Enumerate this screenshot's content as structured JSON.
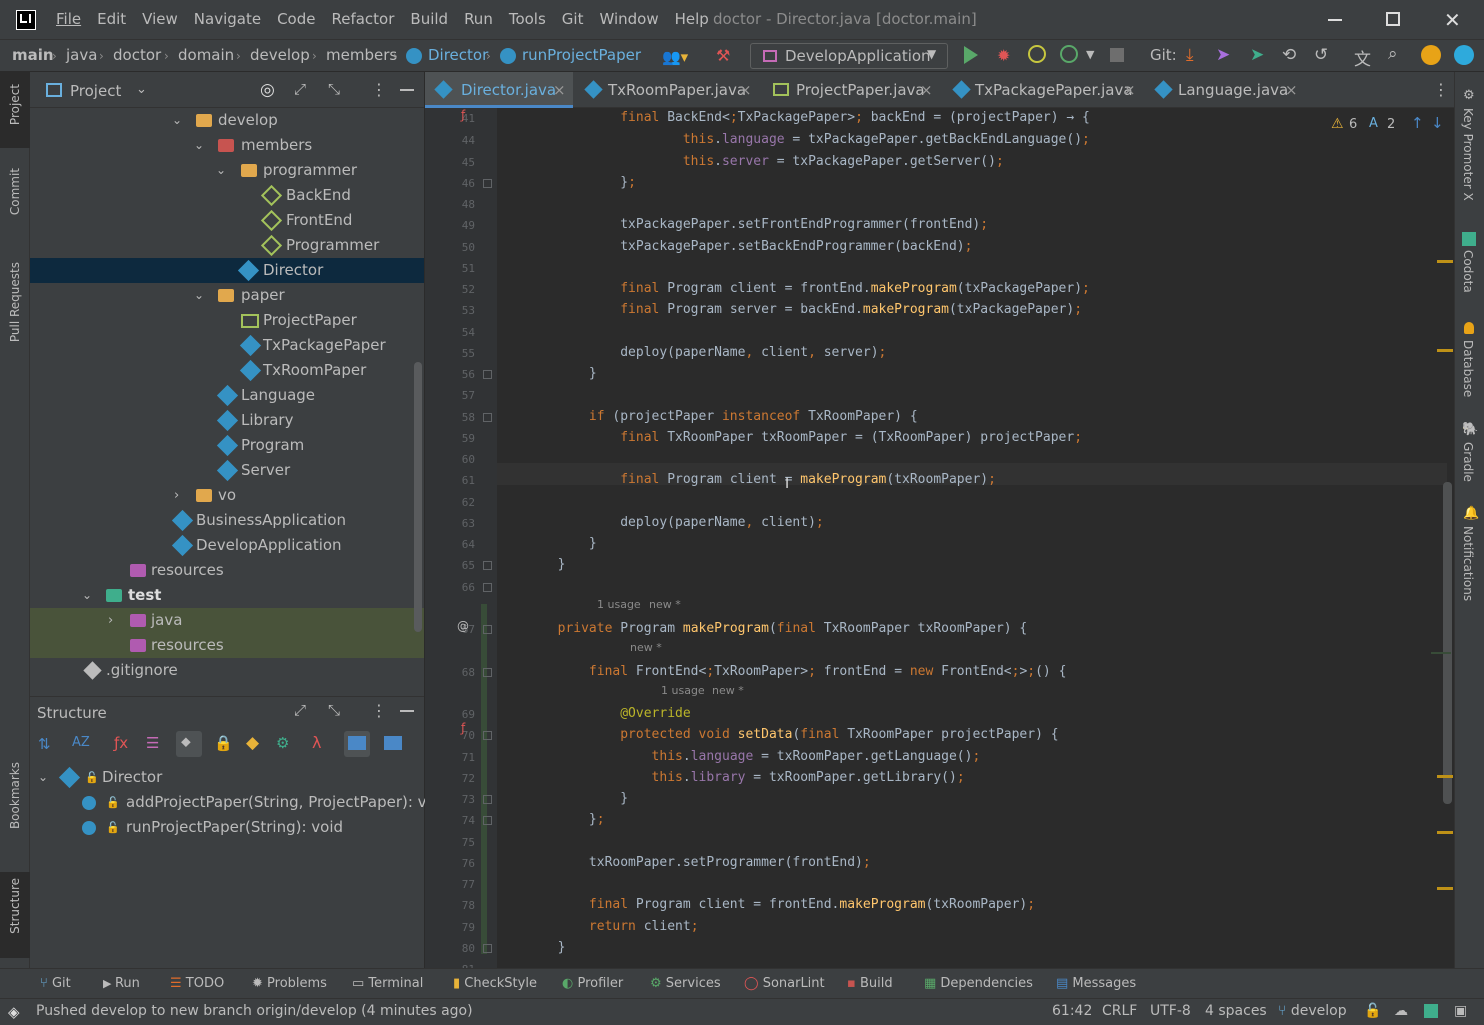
{
  "title_bar": {
    "menus": [
      "File",
      "Edit",
      "View",
      "Navigate",
      "Code",
      "Refactor",
      "Build",
      "Run",
      "Tools",
      "Git",
      "Window",
      "Help"
    ],
    "window_title": "doctor - Director.java [doctor.main]"
  },
  "nav": {
    "crumbs": [
      "main",
      "java",
      "doctor",
      "domain",
      "develop",
      "members",
      "Director",
      "runProjectPaper"
    ],
    "run_config": "DevelopApplication",
    "git_label": "Git:"
  },
  "left_strip": {
    "project": "Project",
    "commit": "Commit",
    "pull_requests": "Pull Requests",
    "bookmarks": "Bookmarks",
    "structure": "Structure"
  },
  "right_strip": {
    "key_promoter": "Key Promoter X",
    "codota": "Codota",
    "database": "Database",
    "gradle": "Gradle",
    "notifications": "Notifications"
  },
  "project_panel": {
    "title": "Project",
    "tree": [
      {
        "label": "develop",
        "kind": "folder"
      },
      {
        "label": "members",
        "kind": "folder-pkg"
      },
      {
        "label": "programmer",
        "kind": "folder"
      },
      {
        "label": "BackEnd",
        "kind": "class-g"
      },
      {
        "label": "FrontEnd",
        "kind": "class-g"
      },
      {
        "label": "Programmer",
        "kind": "class-g"
      },
      {
        "label": "Director",
        "kind": "class"
      },
      {
        "label": "paper",
        "kind": "folder"
      },
      {
        "label": "ProjectPaper",
        "kind": "iface"
      },
      {
        "label": "TxPackagePaper",
        "kind": "class"
      },
      {
        "label": "TxRoomPaper",
        "kind": "class"
      },
      {
        "label": "Language",
        "kind": "class"
      },
      {
        "label": "Library",
        "kind": "class"
      },
      {
        "label": "Program",
        "kind": "class"
      },
      {
        "label": "Server",
        "kind": "class"
      },
      {
        "label": "vo",
        "kind": "folder"
      },
      {
        "label": "BusinessApplication",
        "kind": "class"
      },
      {
        "label": "DevelopApplication",
        "kind": "class"
      },
      {
        "label": "resources",
        "kind": "res"
      },
      {
        "label": "test",
        "kind": "folder-test"
      },
      {
        "label": "java",
        "kind": "src-test"
      },
      {
        "label": "resources",
        "kind": "res"
      },
      {
        "label": ".gitignore",
        "kind": "file"
      }
    ]
  },
  "structure_panel": {
    "title": "Structure",
    "root": "Director",
    "members": [
      "addProjectPaper(String, ProjectPaper): void",
      "runProjectPaper(String): void"
    ]
  },
  "editor": {
    "tabs": [
      "Director.java",
      "TxRoomPaper.java",
      "ProjectPaper.java",
      "TxPackagePaper.java",
      "Language.java"
    ],
    "inspections": {
      "warnings": "6",
      "typos": "2"
    },
    "line_numbers": [
      "41",
      "44",
      "45",
      "46",
      "48",
      "49",
      "50",
      "51",
      "52",
      "53",
      "54",
      "55",
      "56",
      "57",
      "58",
      "59",
      "60",
      "61",
      "62",
      "63",
      "64",
      "65",
      "66",
      "67",
      "68",
      "69",
      "70",
      "71",
      "72",
      "73",
      "74",
      "75",
      "76",
      "77",
      "78",
      "79",
      "80",
      "81"
    ],
    "lines": [
      "                final BackEnd<TxPackagePaper> backEnd = (projectPaper) → {",
      "                        this.language = txPackagePaper.getBackEndLanguage();",
      "                        this.server = txPackagePaper.getServer();",
      "                };",
      "",
      "                txPackagePaper.setFrontEndProgrammer(frontEnd);",
      "                txPackagePaper.setBackEndProgrammer(backEnd);",
      "",
      "                final Program client = frontEnd.makeProgram(txPackagePaper);",
      "                final Program server = backEnd.makeProgram(txPackagePaper);",
      "",
      "                deploy(paperName, client, server);",
      "            }",
      "",
      "            if (projectPaper instanceof TxRoomPaper) {",
      "                final TxRoomPaper txRoomPaper = (TxRoomPaper) projectPaper;",
      "",
      "                final Program client = makeProgram(txRoomPaper);",
      "",
      "                deploy(paperName, client);",
      "            }",
      "        }",
      "",
      "        private Program makeProgram(final TxRoomPaper txRoomPaper) {",
      "            final FrontEnd<TxRoomPaper> frontEnd = new FrontEnd<>() {",
      "                @Override",
      "                protected void setData(final TxRoomPaper projectPaper) {",
      "                    this.language = txRoomPaper.getLanguage();",
      "                    this.library = txRoomPaper.getLibrary();",
      "                }",
      "            };",
      "",
      "            txRoomPaper.setProgrammer(frontEnd);",
      "",
      "            final Program client = frontEnd.makeProgram(txRoomPaper);",
      "            return client;",
      "        }",
      ""
    ],
    "hints": {
      "usage_1": "1 usage",
      "new_1": "new *",
      "new_2": "new *",
      "usage_2": "1 usage",
      "new_3": "new *"
    }
  },
  "bottom_tools": [
    "Git",
    "Run",
    "TODO",
    "Problems",
    "Terminal",
    "CheckStyle",
    "Profiler",
    "Services",
    "SonarLint",
    "Build",
    "Dependencies",
    "Messages"
  ],
  "status": {
    "message": "Pushed develop to new branch origin/develop (4 minutes ago)",
    "position": "61:42",
    "line_sep": "CRLF",
    "encoding": "UTF-8",
    "indent": "4 spaces",
    "branch": "develop"
  },
  "colors": {
    "keyword": "#cc7832",
    "field": "#9876aa",
    "method": "#ffc66d",
    "annotation": "#bbb529",
    "selection": "#0d293e",
    "accent": "#4a88c7"
  }
}
